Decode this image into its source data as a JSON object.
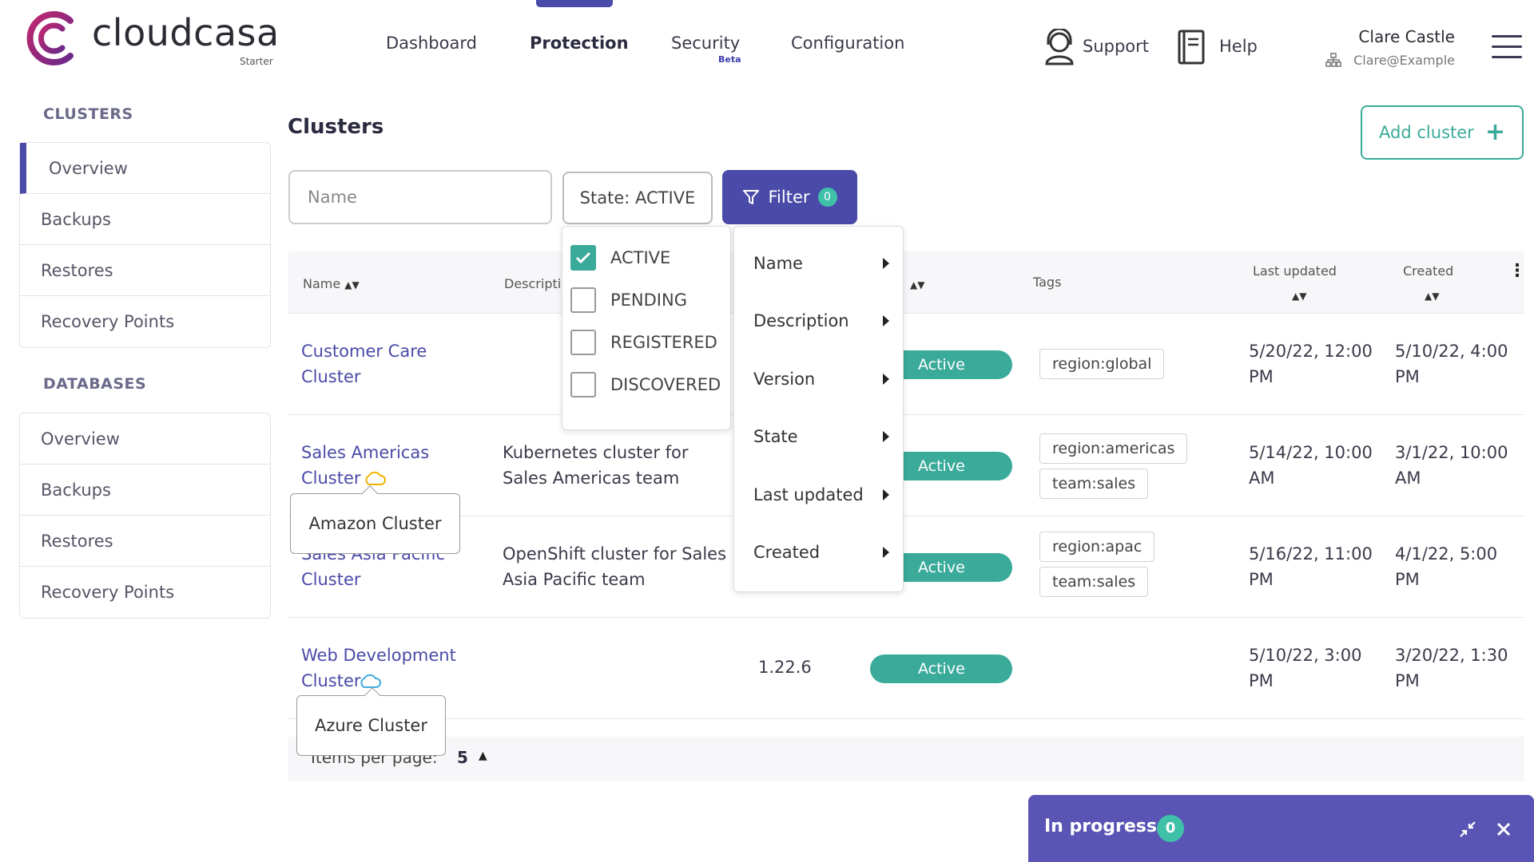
{
  "app": {
    "brand": "cloudcasa",
    "plan": "Starter"
  },
  "nav": {
    "dashboard": "Dashboard",
    "protection": "Protection",
    "security": "Security",
    "security_badge": "Beta",
    "configuration": "Configuration",
    "support": "Support",
    "help": "Help"
  },
  "user": {
    "name": "Clare Castle",
    "email": "Clare@Example"
  },
  "sidebar": {
    "clusters_title": "CLUSTERS",
    "clusters_items": [
      "Overview",
      "Backups",
      "Restores",
      "Recovery Points"
    ],
    "databases_title": "DATABASES",
    "databases_items": [
      "Overview",
      "Backups",
      "Restores",
      "Recovery Points"
    ]
  },
  "page": {
    "title": "Clusters",
    "add_button": "Add cluster",
    "name_placeholder": "Name",
    "state_filter": "State: ACTIVE",
    "filter_label": "Filter",
    "filter_count": "0"
  },
  "table": {
    "headers": {
      "name": "Name",
      "description": "Descripti",
      "tags": "Tags",
      "last_updated": "Last updated",
      "created": "Created"
    },
    "rows": [
      {
        "name": [
          "Customer Care",
          "Cluster"
        ],
        "description": [
          "",
          ""
        ],
        "version": "",
        "state": "Active",
        "tags": [
          "region:global"
        ],
        "last_updated": [
          "5/20/22, 12:00",
          "PM"
        ],
        "created": [
          "5/10/22, 4:00",
          "PM"
        ]
      },
      {
        "name": [
          "Sales Americas",
          "Cluster"
        ],
        "description": [
          "Kubernetes cluster for",
          "Sales Americas team"
        ],
        "version": "",
        "state": "Active",
        "tags": [
          "region:americas",
          "team:sales"
        ],
        "last_updated": [
          "5/14/22, 10:00",
          "AM"
        ],
        "created": [
          "3/1/22, 10:00",
          "AM"
        ]
      },
      {
        "name": [
          "Sales Asia Pacific",
          "Cluster"
        ],
        "description": [
          "OpenShift cluster for Sales",
          "Asia Pacific team"
        ],
        "version": "",
        "state": "Active",
        "tags": [
          "region:apac",
          "team:sales"
        ],
        "last_updated": [
          "5/16/22, 11:00",
          "PM"
        ],
        "created": [
          "4/1/22, 5:00",
          "PM"
        ]
      },
      {
        "name": [
          "Web Development",
          "Cluster"
        ],
        "description": [
          "",
          ""
        ],
        "version": "1.22.6",
        "state": "Active",
        "tags": [],
        "last_updated": [
          "5/10/22, 3:00",
          "PM"
        ],
        "created": [
          "3/20/22, 1:30",
          "PM"
        ]
      }
    ],
    "items_per_page_label": "Items per page:",
    "items_per_page": "5"
  },
  "tooltips": {
    "amazon": "Amazon Cluster",
    "azure": "Azure Cluster"
  },
  "state_menu": {
    "options": [
      {
        "label": "ACTIVE",
        "checked": true
      },
      {
        "label": "PENDING",
        "checked": false
      },
      {
        "label": "REGISTERED",
        "checked": false
      },
      {
        "label": "DISCOVERED",
        "checked": false
      }
    ]
  },
  "filter_menu": {
    "items": [
      "Name",
      "Description",
      "Version",
      "State",
      "Last updated",
      "Created"
    ]
  },
  "progress": {
    "label": "In progress",
    "count": "0"
  },
  "colors": {
    "accent": "#4a4aa8",
    "teal": "#3aaa9a",
    "brand_logo": "#b0246e",
    "progress_bg": "#5a55b5"
  }
}
